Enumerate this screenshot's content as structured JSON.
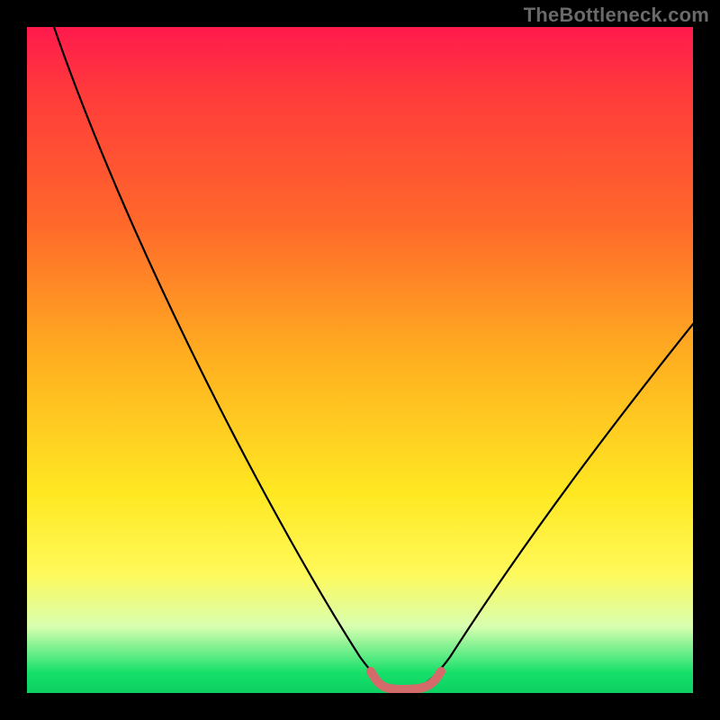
{
  "watermark": "TheBottleneck.com",
  "chart_data": {
    "type": "line",
    "title": "",
    "xlabel": "",
    "ylabel": "",
    "xlim": [
      0,
      100
    ],
    "ylim": [
      0,
      100
    ],
    "series": [
      {
        "name": "curve",
        "x": [
          4,
          10,
          20,
          30,
          40,
          48,
          52,
          55,
          58,
          60,
          64,
          70,
          80,
          90,
          100
        ],
        "y": [
          100,
          88,
          70,
          52,
          33,
          15,
          4,
          0,
          0,
          0,
          4,
          12,
          27,
          42,
          56
        ]
      }
    ],
    "notes": "V-shaped curve over a vertical hue gradient; flat red segment at the trough near the bottom."
  },
  "gradient_colors": {
    "top": "#ff1a4d",
    "mid_upper": "#ff6a2a",
    "mid": "#ffe822",
    "lower": "#d8ffb0",
    "bottom": "#0dd062"
  },
  "trough_marker_color": "#d46a6a"
}
